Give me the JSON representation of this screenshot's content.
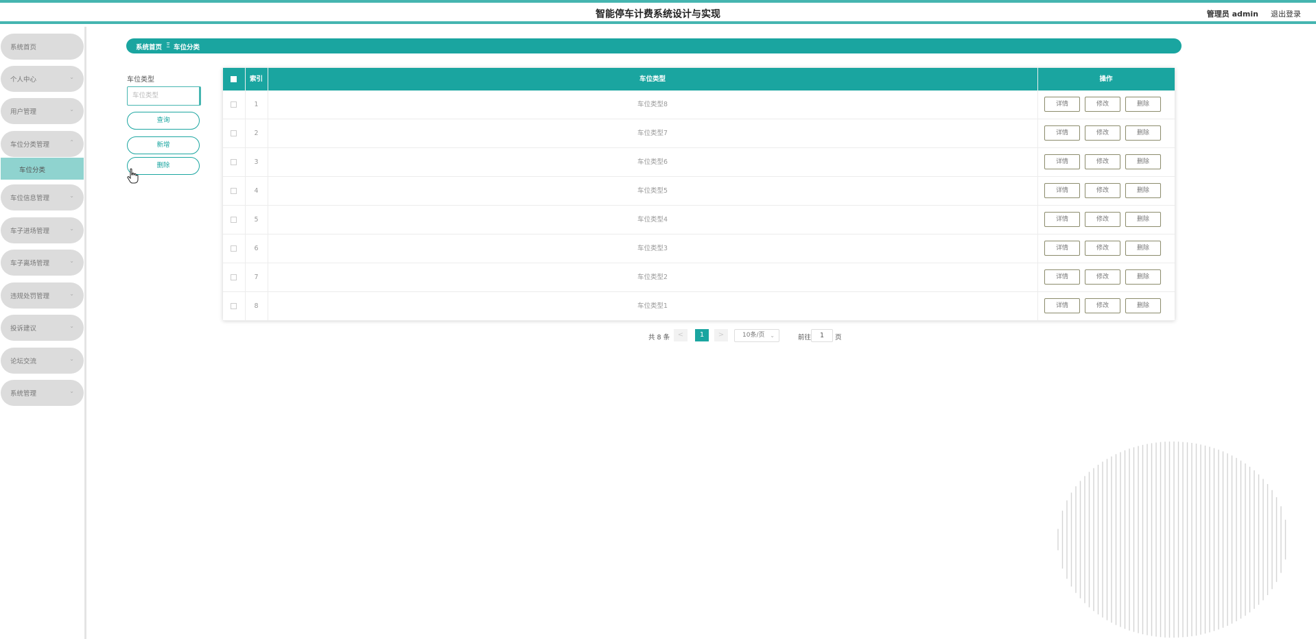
{
  "header": {
    "title": "智能停车计费系统设计与实现",
    "user": "管理员 admin",
    "logout": "退出登录"
  },
  "sidebar": {
    "items": [
      {
        "label": "系统首页",
        "has_chevron": false
      },
      {
        "label": "个人中心",
        "has_chevron": true
      },
      {
        "label": "用户管理",
        "has_chevron": true
      },
      {
        "label": "车位分类管理",
        "has_chevron": true,
        "expanded": true
      },
      {
        "label": "车位信息管理",
        "has_chevron": true
      },
      {
        "label": "车子进场管理",
        "has_chevron": true
      },
      {
        "label": "车子离场管理",
        "has_chevron": true
      },
      {
        "label": "违规处罚管理",
        "has_chevron": true
      },
      {
        "label": "投诉建议",
        "has_chevron": true
      },
      {
        "label": "论坛交流",
        "has_chevron": true
      },
      {
        "label": "系统管理",
        "has_chevron": true
      }
    ],
    "active_sub": "车位分类"
  },
  "breadcrumb": {
    "home": "系统首页",
    "sep": "Ξ",
    "current": "车位分类"
  },
  "search": {
    "label": "车位类型",
    "placeholder": "车位类型",
    "query_btn": "查询",
    "add_btn": "新增",
    "delete_btn": "删除"
  },
  "table": {
    "headers": {
      "index": "索引",
      "type": "车位类型",
      "ops": "操作"
    },
    "rows": [
      {
        "index": "1",
        "type": "车位类型8"
      },
      {
        "index": "2",
        "type": "车位类型7"
      },
      {
        "index": "3",
        "type": "车位类型6"
      },
      {
        "index": "4",
        "type": "车位类型5"
      },
      {
        "index": "5",
        "type": "车位类型4"
      },
      {
        "index": "6",
        "type": "车位类型3"
      },
      {
        "index": "7",
        "type": "车位类型2"
      },
      {
        "index": "8",
        "type": "车位类型1"
      }
    ],
    "actions": {
      "detail": "详情",
      "edit": "修改",
      "delete": "删除"
    }
  },
  "pagination": {
    "total": "共 8 条",
    "prev": "<",
    "current": "1",
    "next": ">",
    "page_size": "10条/页",
    "goto_label": "前往",
    "goto_value": "1",
    "page_suffix": "页"
  },
  "colors": {
    "accent": "#1aa5a0",
    "sidebar_item": "#dcdcdc",
    "sub_active": "#8fd3cf"
  }
}
